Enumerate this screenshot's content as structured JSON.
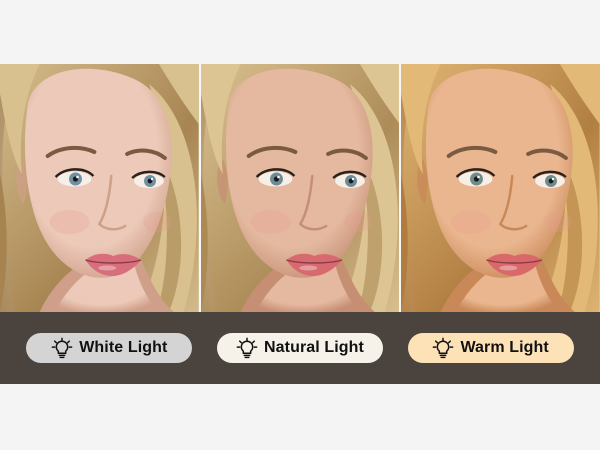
{
  "panels": [
    {
      "id": "white",
      "label": "White Light",
      "pill_color": "#d4d4d4",
      "skin": "#ecc9b8",
      "skin_shadow": "#cf9f89",
      "hair": "#d8c08f",
      "hair_dark": "#a6834f",
      "bg": "#cdbfb1",
      "lip": "#d86d7b",
      "eye": "#6f8fa2",
      "icon": "lightbulb-icon"
    },
    {
      "id": "natural",
      "label": "Natural Light",
      "pill_color": "#f6f2ea",
      "skin": "#e4b9a0",
      "skin_shadow": "#c68f74",
      "hair": "#ddc493",
      "hair_dark": "#ab8a55",
      "bg": "#d8c3b0",
      "lip": "#d66a6f",
      "eye": "#6d8b95",
      "icon": "lightbulb-icon"
    },
    {
      "id": "warm",
      "label": "Warm Light",
      "pill_color": "#fde2b7",
      "skin": "#eab68f",
      "skin_shadow": "#c98858",
      "hair": "#e2b977",
      "hair_dark": "#b07d3f",
      "bg": "#dfb790",
      "lip": "#d9686a",
      "eye": "#708c8a",
      "icon": "lightbulb-icon"
    }
  ]
}
